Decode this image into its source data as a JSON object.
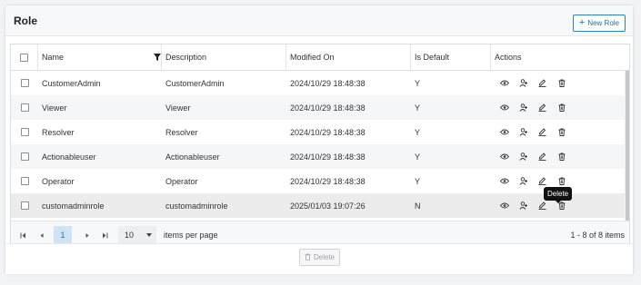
{
  "header": {
    "title": "Role",
    "new_role_label": "New Role"
  },
  "table": {
    "columns": {
      "name": "Name",
      "description": "Description",
      "modified_on": "Modified On",
      "is_default": "Is Default",
      "actions": "Actions"
    },
    "rows": [
      {
        "name": "CustomerAdmin",
        "description": "CustomerAdmin",
        "modified_on": "2024/10/29 18:48:38",
        "is_default": "Y"
      },
      {
        "name": "Viewer",
        "description": "Viewer",
        "modified_on": "2024/10/29 18:48:38",
        "is_default": "Y"
      },
      {
        "name": "Resolver",
        "description": "Resolver",
        "modified_on": "2024/10/29 18:48:38",
        "is_default": "Y"
      },
      {
        "name": "Actionableuser",
        "description": "Actionableuser",
        "modified_on": "2024/10/29 18:48:38",
        "is_default": "Y"
      },
      {
        "name": "Operator",
        "description": "Operator",
        "modified_on": "2024/10/29 18:48:38",
        "is_default": "Y"
      },
      {
        "name": "customadminrole",
        "description": "customadminrole",
        "modified_on": "2025/01/03 19:07:26",
        "is_default": "N"
      }
    ]
  },
  "pager": {
    "current_page": "1",
    "page_size": "10",
    "items_per_page_label": "items per page",
    "info": "1 - 8 of 8 items"
  },
  "footer": {
    "delete_label": "Delete"
  },
  "tooltip": {
    "text": "Delete"
  },
  "colors": {
    "accent": "#1f6fad",
    "selected_page_bg": "#cfe3f6"
  }
}
